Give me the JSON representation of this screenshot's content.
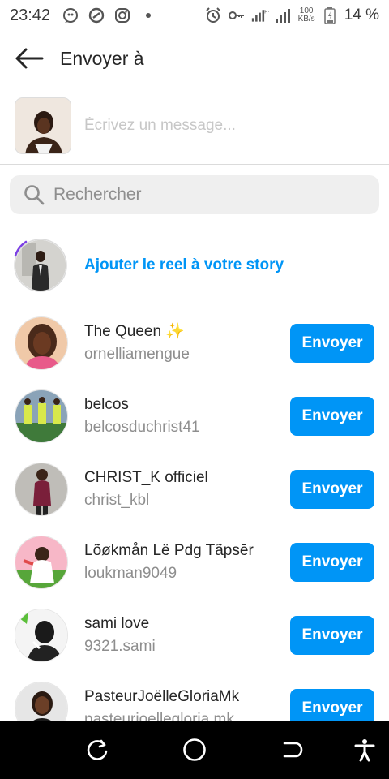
{
  "status_bar": {
    "time": "23:42",
    "speed_value": "100",
    "speed_unit": "KB/s",
    "battery": "14 %",
    "icons": [
      "whatsapp-icon",
      "circle-slash-icon",
      "instagram-icon",
      "dot-icon",
      "alarm-icon",
      "key-icon",
      "signal-h-plus-icon",
      "signal-icon",
      "battery-icon"
    ]
  },
  "header": {
    "back_icon": "arrow-left-icon",
    "title": "Envoyer à"
  },
  "composer": {
    "placeholder": "Écrivez un message..."
  },
  "search": {
    "icon": "search-icon",
    "placeholder": "Rechercher"
  },
  "story": {
    "label": "Ajouter le reel à votre story"
  },
  "contacts": [
    {
      "name": "The Queen ✨",
      "username": "ornelliamengue",
      "button": "Envoyer"
    },
    {
      "name": "belcos",
      "username": "belcosduchrist41",
      "button": "Envoyer"
    },
    {
      "name": "CHRIST_K officiel",
      "username": "christ_kbl",
      "button": "Envoyer"
    },
    {
      "name": "Lõøkmån Lë Pdg Tãpsēr",
      "username": "loukman9049",
      "button": "Envoyer"
    },
    {
      "name": "sami love",
      "username": "9321.sami",
      "button": "Envoyer"
    },
    {
      "name": "PasteurJoëlleGloriaMk",
      "username": "pasteurjoellegloria.mk",
      "button": "Envoyer"
    }
  ],
  "colors": {
    "accent": "#0095f6",
    "nav_bg": "#000000"
  },
  "nav_bar": {
    "icons": [
      "recents-icon",
      "home-icon",
      "back-icon",
      "accessibility-icon"
    ]
  }
}
